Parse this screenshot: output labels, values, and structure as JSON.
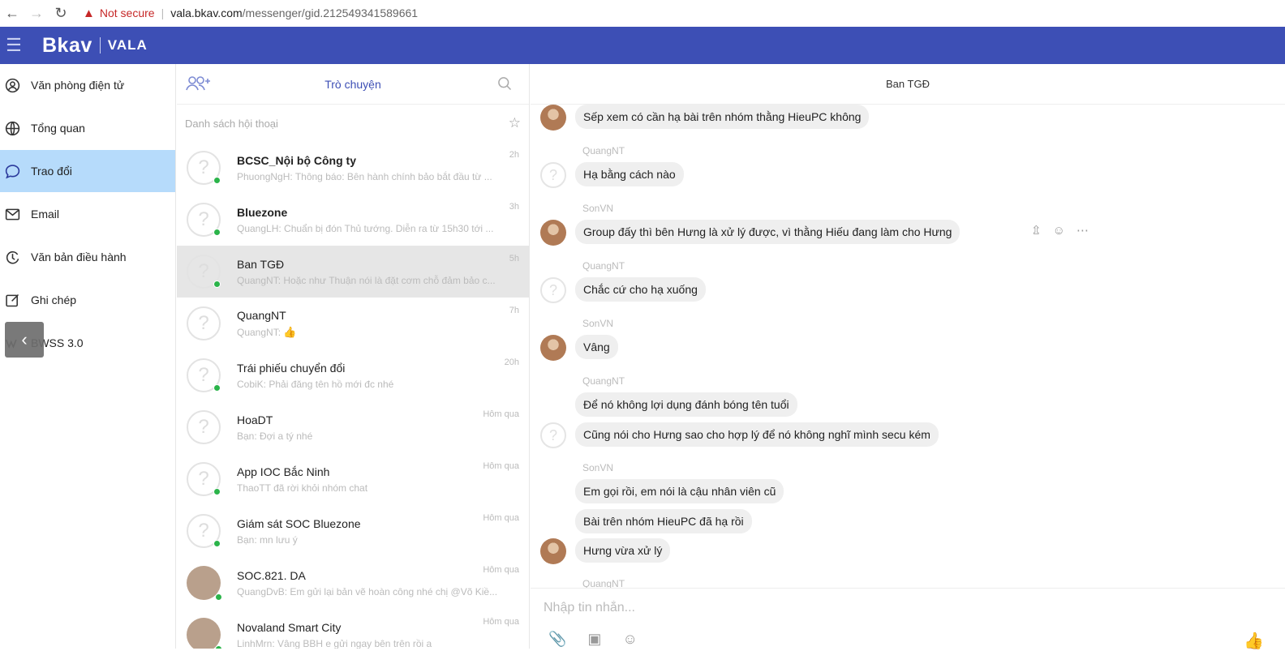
{
  "browser": {
    "not_secure": "Not secure",
    "url_host": "vala.bkav.com",
    "url_path": "/messenger/gid.212549341589661"
  },
  "header": {
    "logo_brand": "Bkav",
    "logo_product": "VALA"
  },
  "sidebar": {
    "items": [
      {
        "label": "Văn phòng điện tử",
        "icon": "office-icon"
      },
      {
        "label": "Tổng quan",
        "icon": "globe-icon"
      },
      {
        "label": "Trao đổi",
        "icon": "chat-icon",
        "active": true
      },
      {
        "label": "Email",
        "icon": "mail-icon"
      },
      {
        "label": "Văn bản điều hành",
        "icon": "document-flow-icon"
      },
      {
        "label": "Ghi chép",
        "icon": "note-icon"
      },
      {
        "label": "BWSS 3.0",
        "icon": "bwss-icon"
      }
    ]
  },
  "convlist": {
    "title": "Trò chuyện",
    "subtitle": "Danh sách hội thoại",
    "items": [
      {
        "name": "BCSC_Nội bộ Công ty",
        "preview": "PhuongNgH: Thông báo: Bên hành chính bảo bắt đầu từ ...",
        "time": "2h",
        "bold": true
      },
      {
        "name": "Bluezone",
        "preview": "QuangLH: Chuẩn bị đón Thủ tướng. Diễn ra từ 15h30 tới ...",
        "time": "3h",
        "bold": true
      },
      {
        "name": "Ban TGĐ",
        "preview": "QuangNT: Hoặc như Thuận nói là đặt cơm chỗ đảm bảo c...",
        "time": "5h",
        "active": true
      },
      {
        "name": "QuangNT",
        "preview": "QuangNT:",
        "time": "7h"
      },
      {
        "name": "Trái phiếu chuyển đổi",
        "preview": "CobiK: Phải đăng tên hồ mới đc nhé",
        "time": "20h"
      },
      {
        "name": "HoaDT",
        "preview": "Bạn: Đợi a tý nhé",
        "time": "Hôm qua"
      },
      {
        "name": "App IOC Bắc Ninh",
        "preview": "ThaoTT đã rời khỏi nhóm chat",
        "time": "Hôm qua"
      },
      {
        "name": "Giám sát SOC Bluezone",
        "preview": "Bạn: mn lưu ý",
        "time": "Hôm qua"
      },
      {
        "name": "SOC.821. DA",
        "preview": "QuangDvB: Em gửi lại bản vẽ hoàn công nhé chị @Võ Kiề...",
        "time": "Hôm qua"
      },
      {
        "name": "Novaland Smart City",
        "preview": "LinhMrn: Vâng BBH e gửi ngay bên trên rồi a",
        "time": "Hôm qua"
      }
    ]
  },
  "chat": {
    "title": "Ban TGĐ",
    "messages": [
      {
        "text": "Sếp xem có cần hạ bài trên nhóm thằng HieuPC không"
      },
      {
        "sender": "QuangNT",
        "text": "Hạ bằng cách nào"
      },
      {
        "sender": "SonVN",
        "text": "Group đấy thì bên Hưng là xử lý được, vì thằng Hiếu đang làm cho Hưng"
      },
      {
        "sender": "QuangNT",
        "text": "Chắc cứ cho hạ xuống"
      },
      {
        "sender": "SonVN",
        "text": "Vâng"
      },
      {
        "sender": "QuangNT",
        "text": "Để nó không lợi dụng đánh bóng tên tuổi"
      },
      {
        "text": "Cũng nói cho Hưng sao cho hợp lý để nó không nghĩ mình secu kém"
      },
      {
        "sender": "SonVN",
        "text": "Em gọi rồi, em nói là cậu nhân viên cũ"
      },
      {
        "text": "Bài trên nhóm HieuPC đã hạ rồi"
      },
      {
        "text": "Hưng vừa xử lý"
      },
      {
        "sender": "QuangNT"
      }
    ],
    "composer_placeholder": "Nhập tin nhắn..."
  },
  "colors": {
    "header": "#3d4fb5",
    "active_nav": "#b6dbfb",
    "online": "#2bb44a"
  }
}
